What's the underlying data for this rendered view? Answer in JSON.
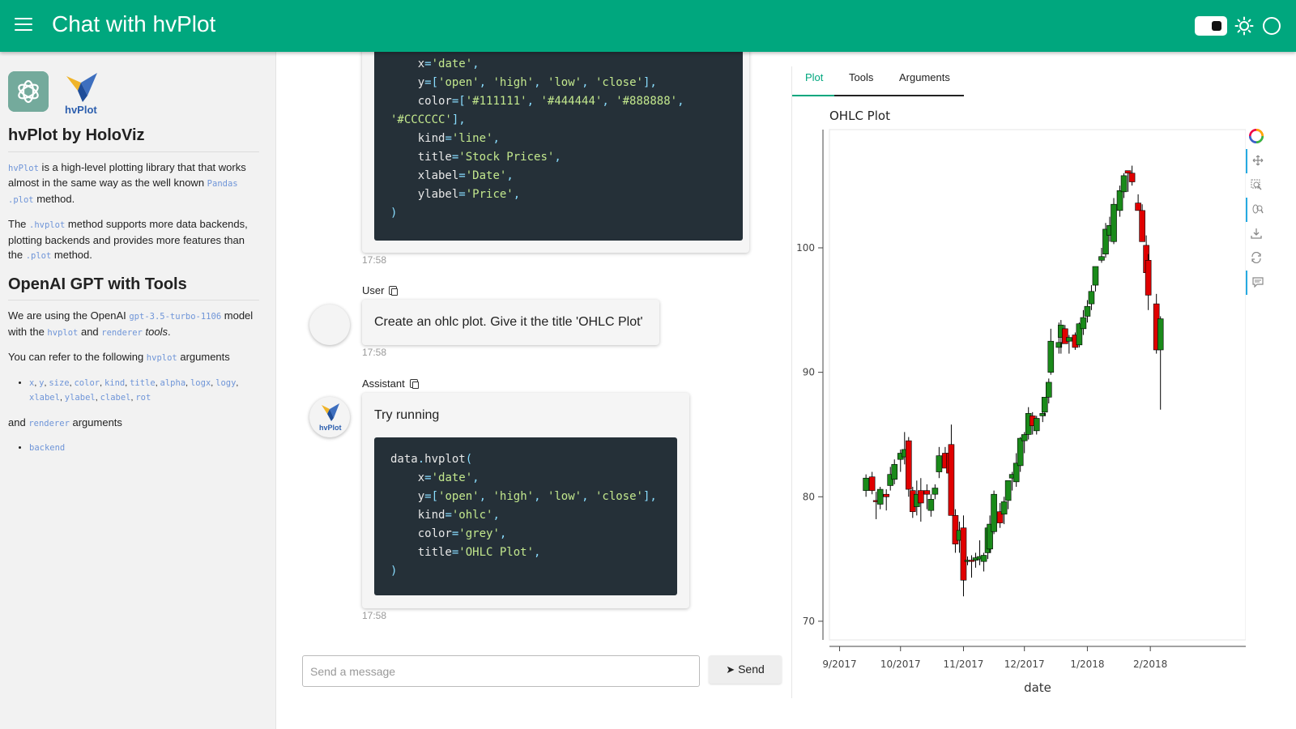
{
  "header": {
    "title": "Chat with hvPlot"
  },
  "sidebar": {
    "title1": "hvPlot by HoloViz",
    "p1_code1": "hvPlot",
    "p1_text1": " is a high-level plotting library that that works almost in the same way as the well known ",
    "p1_code2": "Pandas .plot",
    "p1_text2": " method.",
    "p2_text1": "The ",
    "p2_code1": ".hvplot",
    "p2_text2": " method supports more data backends, plotting backends and provides more features than the ",
    "p2_code2": ".plot",
    "p2_text3": " method.",
    "title2": "OpenAI GPT with Tools",
    "p3_text1": "We are using the OpenAI ",
    "p3_code1": "gpt-3.5-turbo-1106",
    "p3_text2": " model with the ",
    "p3_code2": "hvplot",
    "p3_text3": " and ",
    "p3_code3": "renderer",
    "p3_text4": " ",
    "p3_em": "tools",
    "p3_text5": ".",
    "p4_text1": "You can refer to the following ",
    "p4_code1": "hvplot",
    "p4_text2": " arguments",
    "args": [
      "x",
      "y",
      "size",
      "color",
      "kind",
      "title",
      "alpha",
      "logx",
      "logy",
      "xlabel",
      "ylabel",
      "clabel",
      "rot"
    ],
    "p5_text1": "and ",
    "p5_code1": "renderer",
    "p5_text2": " arguments",
    "renderer_args": [
      "backend"
    ]
  },
  "chat": {
    "msg1": {
      "code_lines": [
        "    x='date',",
        "    y=['open', 'high', 'low', 'close'],",
        "    color=['#111111', '#444444', '#888888',",
        "'#CCCCCC'],",
        "    kind='line',",
        "    title='Stock Prices',",
        "    xlabel='Date',",
        "    ylabel='Price',",
        ")"
      ],
      "time": "17:58"
    },
    "msg2": {
      "author": "User",
      "text": "Create an ohlc plot. Give it the title 'OHLC Plot'",
      "time": "17:58",
      "avatar_glyph": ""
    },
    "msg3": {
      "author": "Assistant",
      "text": "Try running",
      "code_lines": [
        "data.hvplot(",
        "    x='date',",
        "    y=['open', 'high', 'low', 'close'],",
        "    kind='ohlc',",
        "    color='grey',",
        "    title='OHLC Plot',",
        ")"
      ],
      "time": "17:58"
    },
    "input_placeholder": "Send a message",
    "send_label": "Send"
  },
  "panel": {
    "tabs": [
      "Plot",
      "Tools",
      "Arguments"
    ],
    "active_tab": "Plot"
  },
  "chart_data": {
    "type": "ohlc",
    "title": "OHLC Plot",
    "xlabel": "date",
    "ylabel": "",
    "ylim": [
      68.5,
      109.5
    ],
    "xlim": [
      "2017-08-27",
      "2018-03-20"
    ],
    "yticks": [
      70,
      80,
      90,
      100
    ],
    "xticks": [
      {
        "date": "2017-09-01",
        "label": "9/2017"
      },
      {
        "date": "2017-10-01",
        "label": "10/2017"
      },
      {
        "date": "2017-11-01",
        "label": "11/2017"
      },
      {
        "date": "2017-12-01",
        "label": "12/2017"
      },
      {
        "date": "2018-01-01",
        "label": "1/2018"
      },
      {
        "date": "2018-02-01",
        "label": "2/2018"
      }
    ],
    "up_color": "#1a8a1a",
    "down_color": "#e00000",
    "candles": [
      {
        "date": "2017-09-14",
        "open": 80.5,
        "high": 81.8,
        "low": 80.0,
        "close": 81.5
      },
      {
        "date": "2017-09-17",
        "open": 81.6,
        "high": 82.0,
        "low": 80.2,
        "close": 80.5
      },
      {
        "date": "2017-09-19",
        "open": 79.7,
        "high": 80.4,
        "low": 78.2,
        "close": 79.6
      },
      {
        "date": "2017-09-21",
        "open": 79.4,
        "high": 80.8,
        "low": 79.0,
        "close": 80.6
      },
      {
        "date": "2017-09-24",
        "open": 80.2,
        "high": 80.6,
        "low": 78.9,
        "close": 80.0
      },
      {
        "date": "2017-09-26",
        "open": 80.9,
        "high": 82.4,
        "low": 80.5,
        "close": 81.8
      },
      {
        "date": "2017-09-28",
        "open": 81.4,
        "high": 83.0,
        "low": 81.0,
        "close": 82.6
      },
      {
        "date": "2017-10-01",
        "open": 83.0,
        "high": 83.8,
        "low": 82.0,
        "close": 83.5
      },
      {
        "date": "2017-10-03",
        "open": 83.2,
        "high": 85.2,
        "low": 82.6,
        "close": 83.8
      },
      {
        "date": "2017-10-05",
        "open": 84.5,
        "high": 84.8,
        "low": 80.0,
        "close": 80.6
      },
      {
        "date": "2017-10-07",
        "open": 80.5,
        "high": 80.8,
        "low": 78.3,
        "close": 78.8
      },
      {
        "date": "2017-10-09",
        "open": 79.2,
        "high": 81.3,
        "low": 78.5,
        "close": 80.2
      },
      {
        "date": "2017-10-11",
        "open": 80.5,
        "high": 81.5,
        "low": 78.0,
        "close": 79.5
      },
      {
        "date": "2017-10-14",
        "open": 80.5,
        "high": 81.0,
        "low": 79.0,
        "close": 80.2
      },
      {
        "date": "2017-10-16",
        "open": 78.9,
        "high": 80.2,
        "low": 78.4,
        "close": 79.8
      },
      {
        "date": "2017-10-18",
        "open": 80.2,
        "high": 81.0,
        "low": 79.8,
        "close": 80.7
      },
      {
        "date": "2017-10-20",
        "open": 82.0,
        "high": 84.0,
        "low": 81.5,
        "close": 83.3
      },
      {
        "date": "2017-10-23",
        "open": 83.5,
        "high": 84.0,
        "low": 82.5,
        "close": 82.3
      },
      {
        "date": "2017-10-25",
        "open": 83.5,
        "high": 84.0,
        "low": 81.0,
        "close": 81.9
      },
      {
        "date": "2017-10-26",
        "open": 84.2,
        "high": 85.8,
        "low": 83.2,
        "close": 78.5
      },
      {
        "date": "2017-10-28",
        "open": 78.5,
        "high": 79.0,
        "low": 75.5,
        "close": 76.2
      },
      {
        "date": "2017-10-30",
        "open": 76.5,
        "high": 78.0,
        "low": 75.5,
        "close": 77.3
      },
      {
        "date": "2017-11-01",
        "open": 77.5,
        "high": 78.5,
        "low": 72.0,
        "close": 73.3
      },
      {
        "date": "2017-11-03",
        "open": 74.8,
        "high": 75.2,
        "low": 74.5,
        "close": 74.9
      },
      {
        "date": "2017-11-05",
        "open": 74.9,
        "high": 75.3,
        "low": 73.5,
        "close": 74.8
      },
      {
        "date": "2017-11-07",
        "open": 74.9,
        "high": 75.5,
        "low": 74.3,
        "close": 75.1
      },
      {
        "date": "2017-11-09",
        "open": 75.0,
        "high": 76.5,
        "low": 74.5,
        "close": 75.2
      },
      {
        "date": "2017-11-11",
        "open": 74.8,
        "high": 75.5,
        "low": 74.0,
        "close": 75.3
      },
      {
        "date": "2017-11-13",
        "open": 75.5,
        "high": 77.5,
        "low": 75.0,
        "close": 77.5
      },
      {
        "date": "2017-11-14",
        "open": 75.8,
        "high": 78.5,
        "low": 75.5,
        "close": 77.8
      },
      {
        "date": "2017-11-16",
        "open": 77.2,
        "high": 80.5,
        "low": 77.0,
        "close": 80.2
      },
      {
        "date": "2017-11-19",
        "open": 78.8,
        "high": 79.5,
        "low": 77.5,
        "close": 77.9
      },
      {
        "date": "2017-11-21",
        "open": 78.6,
        "high": 80.0,
        "low": 77.8,
        "close": 79.6
      },
      {
        "date": "2017-11-23",
        "open": 79.7,
        "high": 81.0,
        "low": 79.0,
        "close": 81.3
      },
      {
        "date": "2017-11-25",
        "open": 81.5,
        "high": 82.0,
        "low": 80.5,
        "close": 81.8
      },
      {
        "date": "2017-11-27",
        "open": 81.2,
        "high": 83.5,
        "low": 80.8,
        "close": 82.7
      },
      {
        "date": "2017-11-29",
        "open": 82.5,
        "high": 84.8,
        "low": 82.0,
        "close": 84.7
      },
      {
        "date": "2017-12-01",
        "open": 84.5,
        "high": 85.2,
        "low": 83.5,
        "close": 85.0
      },
      {
        "date": "2017-12-03",
        "open": 85.0,
        "high": 87.2,
        "low": 84.6,
        "close": 86.7
      },
      {
        "date": "2017-12-05",
        "open": 86.5,
        "high": 86.8,
        "low": 85.0,
        "close": 85.7
      },
      {
        "date": "2017-12-07",
        "open": 85.3,
        "high": 86.5,
        "low": 85.0,
        "close": 86.3
      },
      {
        "date": "2017-12-10",
        "open": 86.5,
        "high": 87.0,
        "low": 86.0,
        "close": 86.7
      },
      {
        "date": "2017-12-11",
        "open": 86.8,
        "high": 88.0,
        "low": 86.5,
        "close": 88.0
      },
      {
        "date": "2017-12-13",
        "open": 88.0,
        "high": 89.5,
        "low": 87.5,
        "close": 89.2
      },
      {
        "date": "2017-12-14",
        "open": 90.0,
        "high": 93.5,
        "low": 89.8,
        "close": 92.5
      },
      {
        "date": "2017-12-18",
        "open": 92.0,
        "high": 94.0,
        "low": 91.5,
        "close": 92.4
      },
      {
        "date": "2017-12-19",
        "open": 92.8,
        "high": 94.2,
        "low": 91.5,
        "close": 93.8
      },
      {
        "date": "2017-12-21",
        "open": 93.5,
        "high": 93.8,
        "low": 92.5,
        "close": 92.3
      },
      {
        "date": "2017-12-23",
        "open": 92.5,
        "high": 93.0,
        "low": 91.5,
        "close": 92.8
      },
      {
        "date": "2017-12-26",
        "open": 93.0,
        "high": 93.2,
        "low": 91.8,
        "close": 92.0
      },
      {
        "date": "2017-12-28",
        "open": 92.2,
        "high": 94.0,
        "low": 92.0,
        "close": 93.9
      },
      {
        "date": "2017-12-30",
        "open": 93.5,
        "high": 95.0,
        "low": 93.0,
        "close": 94.4
      },
      {
        "date": "2018-01-01",
        "open": 94.5,
        "high": 95.8,
        "low": 94.0,
        "close": 95.3
      },
      {
        "date": "2018-01-03",
        "open": 95.5,
        "high": 97.0,
        "low": 95.0,
        "close": 96.5
      },
      {
        "date": "2018-01-05",
        "open": 97.0,
        "high": 98.5,
        "low": 96.5,
        "close": 98.5
      },
      {
        "date": "2018-01-08",
        "open": 99.0,
        "high": 100.0,
        "low": 98.8,
        "close": 99.3
      },
      {
        "date": "2018-01-10",
        "open": 99.5,
        "high": 102.0,
        "low": 99.2,
        "close": 101.5
      },
      {
        "date": "2018-01-12",
        "open": 101.0,
        "high": 102.5,
        "low": 100.5,
        "close": 101.8
      },
      {
        "date": "2018-01-14",
        "open": 100.5,
        "high": 104.0,
        "low": 100.3,
        "close": 103.5
      },
      {
        "date": "2018-01-17",
        "open": 103.0,
        "high": 105.0,
        "low": 102.5,
        "close": 104.6
      },
      {
        "date": "2018-01-19",
        "open": 104.5,
        "high": 106.0,
        "low": 104.0,
        "close": 105.8
      },
      {
        "date": "2018-01-21",
        "open": 106.2,
        "high": 106.2,
        "low": 104.5,
        "close": 106.0
      },
      {
        "date": "2018-01-23",
        "open": 106.0,
        "high": 106.6,
        "low": 105.0,
        "close": 105.3
      },
      {
        "date": "2018-01-26",
        "open": 103.6,
        "high": 104.3,
        "low": 103.0,
        "close": 103.0
      },
      {
        "date": "2018-01-28",
        "open": 103.0,
        "high": 103.5,
        "low": 101.0,
        "close": 100.5
      },
      {
        "date": "2018-01-30",
        "open": 100.2,
        "high": 101.0,
        "low": 97.5,
        "close": 98.0
      },
      {
        "date": "2018-01-31",
        "open": 99.0,
        "high": 99.5,
        "low": 95.0,
        "close": 96.2
      },
      {
        "date": "2018-02-04",
        "open": 95.5,
        "high": 96.3,
        "low": 91.5,
        "close": 91.8
      },
      {
        "date": "2018-02-06",
        "open": 91.8,
        "high": 94.5,
        "low": 87.0,
        "close": 94.3
      }
    ]
  }
}
